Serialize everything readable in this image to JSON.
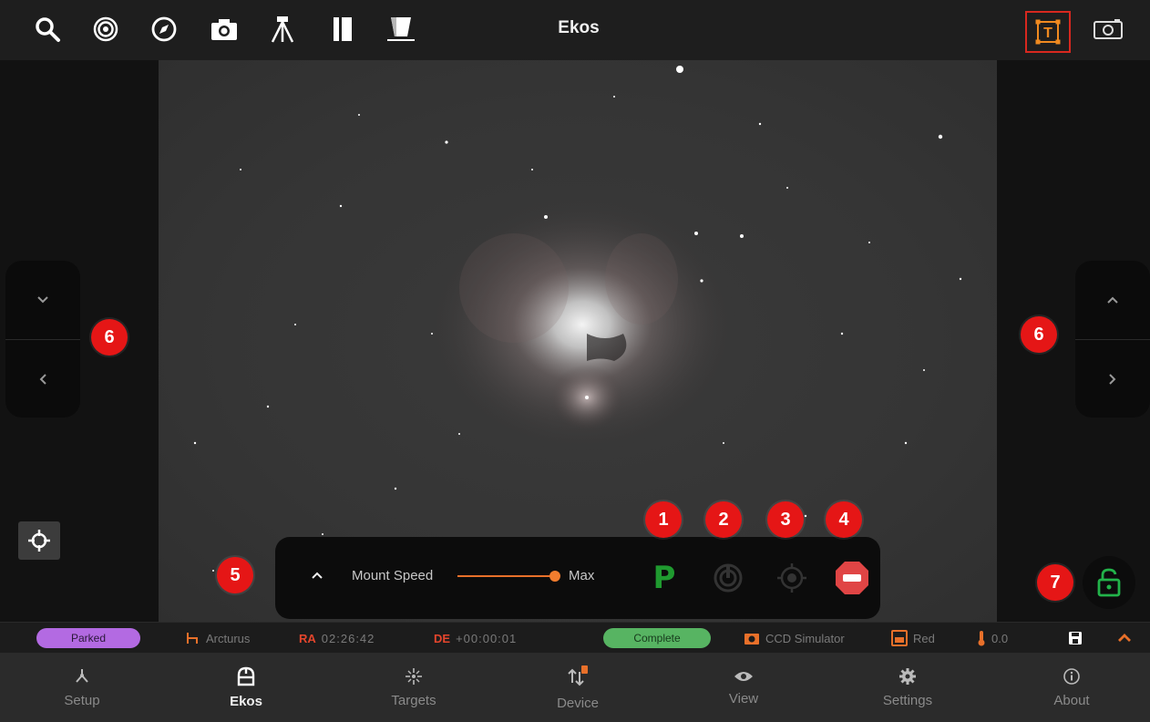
{
  "app": {
    "title": "Ekos"
  },
  "toolbar": {
    "icons": [
      "search-icon",
      "target-icon",
      "compass-icon",
      "camera-icon",
      "tripod-icon",
      "book-icon",
      "filter-icon"
    ],
    "right_icons": [
      "text-frame-icon",
      "capture-frame-icon"
    ]
  },
  "annotations": {
    "left_pad": "6",
    "right_pad": "6",
    "mount_panel": "5",
    "park": "1",
    "track": "2",
    "center": "3",
    "stop": "4",
    "lock": "7"
  },
  "mount_control": {
    "speed_label": "Mount Speed",
    "speed_value_label": "Max",
    "speed_level": 1.0
  },
  "status": {
    "mount_state": "Parked",
    "target_name": "Arcturus",
    "ra_label": "RA",
    "ra_value": "02:26:42",
    "de_label": "DE",
    "de_value": "+00:00:01",
    "capture_state": "Complete",
    "camera_name": "CCD Simulator",
    "filter_name": "Red",
    "temperature": "0.0"
  },
  "bottom_nav": [
    {
      "label": "Setup",
      "icon": "setup-icon",
      "active": false
    },
    {
      "label": "Ekos",
      "icon": "ekos-icon",
      "active": true
    },
    {
      "label": "Targets",
      "icon": "targets-icon",
      "active": false
    },
    {
      "label": "Device",
      "icon": "device-icon",
      "active": false
    },
    {
      "label": "View",
      "icon": "eye-icon",
      "active": false
    },
    {
      "label": "Settings",
      "icon": "gear-icon",
      "active": false
    },
    {
      "label": "About",
      "icon": "info-icon",
      "active": false
    }
  ],
  "colors": {
    "accent": "#e8702a",
    "badge": "#e51616",
    "park_green": "#1f9a2f",
    "parked_pill": "#b36ae2",
    "complete_pill": "#57b462"
  }
}
